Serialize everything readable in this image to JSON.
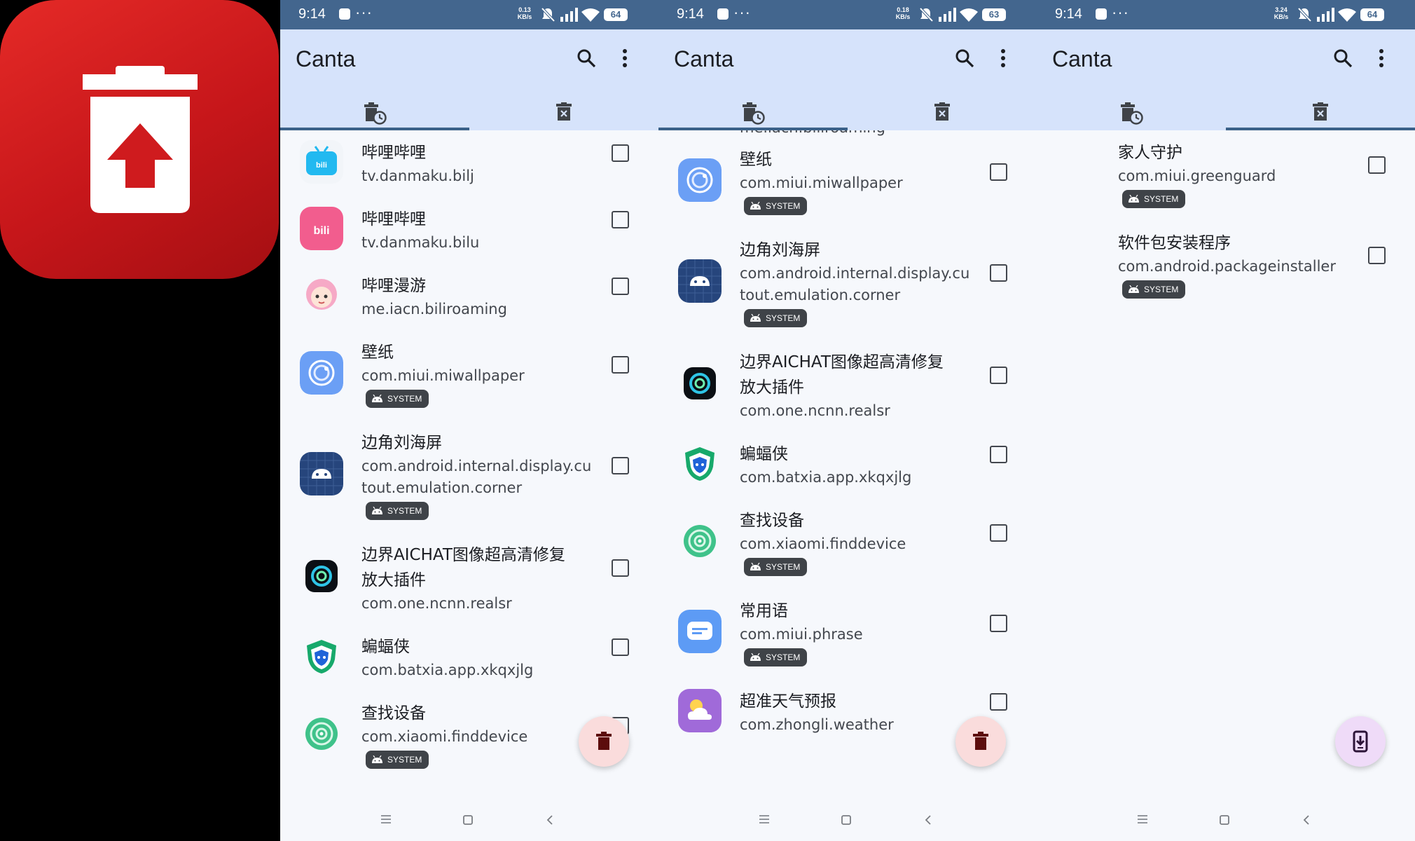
{
  "logo": {
    "name": "canta-logo",
    "color": "#d21d20"
  },
  "screens": [
    {
      "status": {
        "time": "9:14",
        "dots": "···",
        "speed": [
          "0.13",
          "KB/s"
        ],
        "battery": "64"
      },
      "app_title": "Canta",
      "active_tab": 0,
      "cut_top_text": "",
      "apps": [
        {
          "name": "哔哩哔哩",
          "package": "tv.danmaku.bilj",
          "system": false,
          "icon": "bilibili-tv"
        },
        {
          "name": "哔哩哔哩",
          "package": "tv.danmaku.bilu",
          "system": false,
          "icon": "bilibili-pink"
        },
        {
          "name": "哔哩漫游",
          "package": "me.iacn.biliroaming",
          "system": false,
          "icon": "anime-girl"
        },
        {
          "name": "壁纸",
          "package": "com.miui.miwallpaper",
          "system": true,
          "icon": "wallpaper"
        },
        {
          "name": "边角刘海屏",
          "package": "com.android.internal.display.cutout.emulation.corner",
          "package_lines": [
            "com.android.internal.display.cu",
            "tout.emulation.corner"
          ],
          "system": true,
          "icon": "android-grid"
        },
        {
          "name_lines": [
            "边界AICHAT图像超高清修复",
            "放大插件"
          ],
          "package": "com.one.ncnn.realsr",
          "system": false,
          "icon": "realsr"
        },
        {
          "name": "蝙蝠侠",
          "package": "com.batxia.app.xkqxjlg",
          "system": false,
          "icon": "batxia"
        },
        {
          "name": "查找设备",
          "package": "com.xiaomi.finddevice",
          "system": true,
          "icon": "finddevice"
        }
      ],
      "fab": "delete"
    },
    {
      "status": {
        "time": "9:14",
        "dots": "···",
        "speed": [
          "0.18",
          "KB/s"
        ],
        "battery": "63"
      },
      "app_title": "Canta",
      "active_tab": 0,
      "cut_top_text": "me.iacn.biliroaming",
      "apps": [
        {
          "name": "壁纸",
          "package": "com.miui.miwallpaper",
          "system": true,
          "icon": "wallpaper"
        },
        {
          "name": "边角刘海屏",
          "package": "com.android.internal.display.cutout.emulation.corner",
          "package_lines": [
            "com.android.internal.display.cu",
            "tout.emulation.corner"
          ],
          "system": true,
          "icon": "android-grid"
        },
        {
          "name_lines": [
            "边界AICHAT图像超高清修复",
            "放大插件"
          ],
          "package": "com.one.ncnn.realsr",
          "system": false,
          "icon": "realsr"
        },
        {
          "name": "蝙蝠侠",
          "package": "com.batxia.app.xkqxjlg",
          "system": false,
          "icon": "batxia"
        },
        {
          "name": "查找设备",
          "package": "com.xiaomi.finddevice",
          "system": true,
          "icon": "finddevice"
        },
        {
          "name": "常用语",
          "package": "com.miui.phrase",
          "system": true,
          "icon": "phrase"
        },
        {
          "name": "超准天气预报",
          "package": "com.zhongli.weather",
          "system": false,
          "icon": "weather"
        }
      ],
      "fab": "delete"
    },
    {
      "status": {
        "time": "9:14",
        "dots": "···",
        "speed": [
          "3.24",
          "KB/s"
        ],
        "battery": "64"
      },
      "app_title": "Canta",
      "active_tab": 1,
      "cut_top_text": "",
      "apps": [
        {
          "name": "家人守护",
          "package": "com.miui.greenguard",
          "system": true,
          "icon": "none"
        },
        {
          "name": "软件包安装程序",
          "package": "com.android.packageinstaller",
          "system": true,
          "icon": "none"
        }
      ],
      "fab": "restore"
    }
  ],
  "system_badge_label": "SYSTEM",
  "colors": {
    "statusbar": "#43668e",
    "appbar": "#d6e3fb",
    "background": "#f6f8fc",
    "tab_indicator": "#3b6189",
    "fab_delete_bg": "#fadcdc",
    "fab_delete_icon": "#5c0d0d",
    "fab_restore_bg": "#efdbf8",
    "fab_restore_icon": "#2d1438"
  }
}
